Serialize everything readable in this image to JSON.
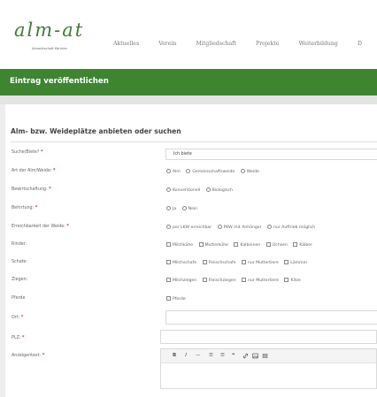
{
  "header": {
    "logo_text": "alm-at",
    "logo_tagline": "Almwirtschaft Kärnten",
    "nav": [
      "Aktuelles",
      "Verein",
      "Mitgliedschaft",
      "Projekte",
      "Weiterbildung",
      "D"
    ]
  },
  "banner": {
    "title": "Eintrag veröffentlichen"
  },
  "form": {
    "section_title": "Alm- bzw. Weideplätze anbieten oder suchen",
    "required_marker": "*",
    "suche_biete": {
      "label": "Suche/Biete?",
      "value": "Ich biete"
    },
    "art": {
      "label": "Art der Alm/Weide:",
      "options": [
        "Alm",
        "Gemeinschaftsweide",
        "Weide"
      ]
    },
    "bewirtschaftung": {
      "label": "Bewirtschaftung:",
      "options": [
        "Konventionell",
        "Biologisch"
      ]
    },
    "behirtung": {
      "label": "Behirtung:",
      "options": [
        "Ja",
        "Nein"
      ]
    },
    "erreichbarkeit": {
      "label": "Erreichbarkeit der Weide:",
      "options": [
        "per LKW erreichbar",
        "PKW mit Anhänger",
        "nur Auftrieb möglich"
      ]
    },
    "rinder": {
      "label": "Rinder:",
      "options": [
        "Milchkühe",
        "Mutterkühe",
        "Kalbinnen",
        "Ochsen",
        "Kälber"
      ]
    },
    "schafe": {
      "label": "Schafe:",
      "options": [
        "Milchschafe",
        "Fleischschafe",
        "nur Muttertiere",
        "Lämmer"
      ]
    },
    "ziegen": {
      "label": "Ziegen:",
      "options": [
        "Milchziegen",
        "Fleischziegen",
        "nur Muttertiere",
        "Kitze"
      ]
    },
    "pferde": {
      "label": "Pferde",
      "options": [
        "Pferde"
      ]
    },
    "ort": {
      "label": "Ort:",
      "value": ""
    },
    "plz": {
      "label": "PLZ:",
      "value": ""
    },
    "anzeigentext": {
      "label": "Anzeigentext:",
      "toolbar": [
        "bold-icon",
        "italic-icon",
        "horizontal-rule-icon",
        "bullet-list-icon",
        "numbered-list-icon",
        "quote-icon",
        "link-icon",
        "image-icon",
        "table-icon"
      ],
      "toolbar_glyphs": {
        "bold": "B",
        "italic": "I",
        "rule": "—",
        "bullets": "☰",
        "numbers": "☰",
        "quote": "❝",
        "link": "🔗",
        "image": "▣",
        "table": "▦"
      }
    }
  },
  "colors": {
    "brand_green": "#3e8431",
    "logo_green": "#3d7d33",
    "required_red": "#d9302c"
  }
}
